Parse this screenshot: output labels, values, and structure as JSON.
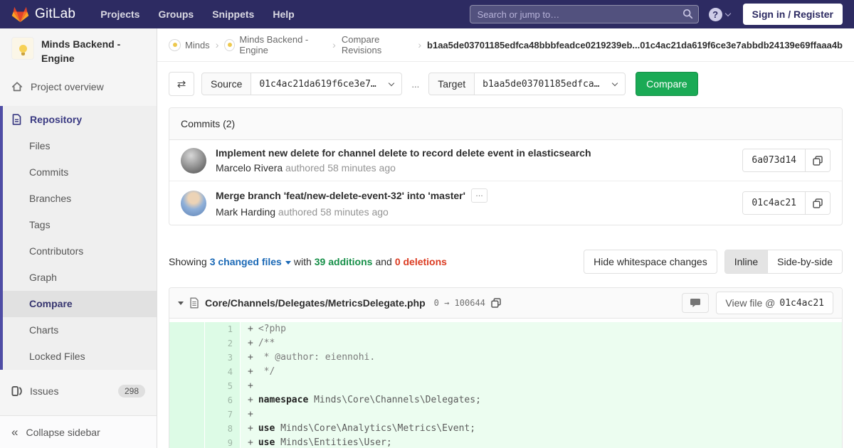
{
  "nav": {
    "logo": "GitLab",
    "items": [
      "Projects",
      "Groups",
      "Snippets",
      "Help"
    ],
    "search_placeholder": "Search or jump to…",
    "help": "?",
    "signin": "Sign in / Register"
  },
  "breadcrumb": {
    "items": [
      "Minds",
      "Minds Backend - Engine",
      "Compare Revisions"
    ],
    "current": "b1aa5de03701185edfca48bbbfeadce0219239eb...01c4ac21da619f6ce3e7abbdb24139e69ffaaa4b"
  },
  "sidebar": {
    "project_title": "Minds Backend - Engine",
    "project_overview": "Project overview",
    "repository": "Repository",
    "repo_items": [
      "Files",
      "Commits",
      "Branches",
      "Tags",
      "Contributors",
      "Graph",
      "Compare",
      "Charts",
      "Locked Files"
    ],
    "issues": "Issues",
    "issues_count": "298",
    "collapse": "Collapse sidebar"
  },
  "compare_bar": {
    "source_label": "Source",
    "source_value": "01c4ac21da619f6ce3e7…",
    "separator": "...",
    "target_label": "Target",
    "target_value": "b1aa5de03701185edfca…",
    "compare_button": "Compare"
  },
  "commits": {
    "header": "Commits (2)",
    "items": [
      {
        "title": "Implement new delete for channel delete to record delete event in elasticsearch",
        "author": "Marcelo Rivera",
        "meta": "authored 58 minutes ago",
        "sha": "6a073d14"
      },
      {
        "title": "Merge branch 'feat/new-delete-event-32' into 'master'",
        "author": "Mark Harding",
        "meta": "authored 58 minutes ago",
        "sha": "01c4ac21",
        "expand": "…"
      }
    ]
  },
  "summary": {
    "showing": "Showing",
    "changed_files": "3 changed files",
    "with": "with",
    "additions": "39 additions",
    "and": "and",
    "deletions": "0 deletions",
    "hide_whitespace": "Hide whitespace changes",
    "inline": "Inline",
    "side_by_side": "Side-by-side"
  },
  "file": {
    "path": "Core/Channels/Delegates/MetricsDelegate.php",
    "mode": "0 → 100644",
    "view_file": "View file @",
    "view_sha": "01c4ac21"
  },
  "diff": {
    "lines": [
      {
        "num": "1",
        "sign": "+",
        "keyword": "",
        "code": "<?php"
      },
      {
        "num": "2",
        "sign": "+",
        "keyword": "",
        "code": "/**"
      },
      {
        "num": "3",
        "sign": "+",
        "keyword": "",
        "code": " * @author: eiennohi."
      },
      {
        "num": "4",
        "sign": "+",
        "keyword": "",
        "code": " */"
      },
      {
        "num": "5",
        "sign": "+",
        "keyword": "",
        "code": ""
      },
      {
        "num": "6",
        "sign": "+",
        "keyword": "namespace",
        "code": " Minds\\Core\\Channels\\Delegates;"
      },
      {
        "num": "7",
        "sign": "+",
        "keyword": "",
        "code": ""
      },
      {
        "num": "8",
        "sign": "+",
        "keyword": "use",
        "code": " Minds\\Core\\Analytics\\Metrics\\Event;"
      },
      {
        "num": "9",
        "sign": "+",
        "keyword": "use",
        "code": " Minds\\Entities\\User;"
      }
    ]
  },
  "colors": {
    "navbar_bg": "#2d2b62",
    "accent_indigo": "#4f4da5",
    "link_blue": "#1b69b6",
    "additions_green": "#168f48",
    "deletions_red": "#db3b21",
    "button_green": "#1aaa55",
    "diff_add_bg": "#ecfdf0",
    "diff_gutter_bg": "#ddfbe6"
  }
}
